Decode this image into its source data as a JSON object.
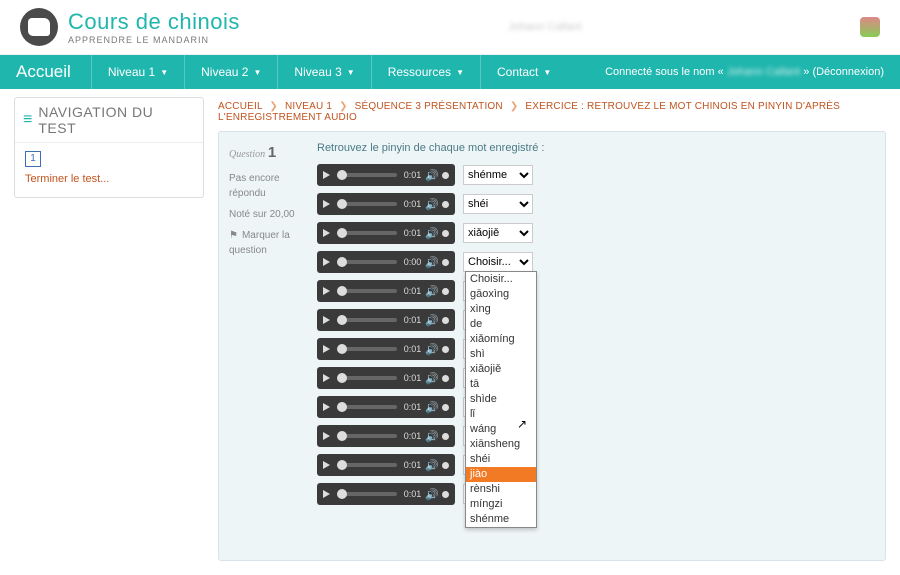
{
  "brand": {
    "title": "Cours de chinois",
    "subtitle": "APPRENDRE LE MANDARIN"
  },
  "nav": {
    "home": "Accueil",
    "items": [
      "Niveau 1",
      "Niveau 2",
      "Niveau 3",
      "Ressources",
      "Contact"
    ],
    "login_prefix": "Connecté sous le nom «",
    "username": "Johann Callant",
    "login_suffix": "» (",
    "logout": "Déconnexion",
    "login_end": ")"
  },
  "sidebar": {
    "title": "NAVIGATION DU TEST",
    "qnum": "1",
    "finish": "Terminer le test..."
  },
  "breadcrumb": {
    "a": "ACCUEIL",
    "b": "NIVEAU 1",
    "c": "SÉQUENCE 3 PRÉSENTATION",
    "d": "EXERCICE : RETROUVEZ LE MOT CHINOIS EN PINYIN D'APRÈS L'ENREGISTREMENT AUDIO"
  },
  "qinfo": {
    "label": "Question",
    "n": "1",
    "status": "Pas encore répondu",
    "score": "Noté sur 20,00",
    "flag": "Marquer la question"
  },
  "exercise": {
    "prompt": "Retrouvez le pinyin de chaque mot enregistré :",
    "placeholder": "Choisir...",
    "rows": [
      {
        "time": "0:01",
        "answer": "shénme"
      },
      {
        "time": "0:01",
        "answer": "shéi"
      },
      {
        "time": "0:01",
        "answer": "xiǎojiě"
      },
      {
        "time": "0:00",
        "answer": ""
      },
      {
        "time": "0:01",
        "answer": ""
      },
      {
        "time": "0:01",
        "answer": ""
      },
      {
        "time": "0:01",
        "answer": ""
      },
      {
        "time": "0:01",
        "answer": ""
      },
      {
        "time": "0:01",
        "answer": ""
      },
      {
        "time": "0:01",
        "answer": ""
      },
      {
        "time": "0:01",
        "answer": ""
      },
      {
        "time": "0:01",
        "answer": ""
      }
    ],
    "options": [
      "Choisir...",
      "gāoxìng",
      "xìng",
      "de",
      "xiǎomíng",
      "shì",
      "xiǎojiě",
      "tā",
      "shìde",
      "lǐ",
      "wáng",
      "xiānsheng",
      "shéi",
      "jiào",
      "rènshi",
      "míngzi",
      "shénme"
    ],
    "highlight_index": 13
  }
}
